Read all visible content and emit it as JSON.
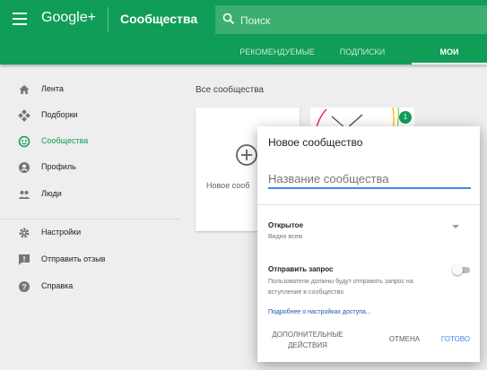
{
  "appbar": {
    "logo": "Google+",
    "title": "Сообщества",
    "search_placeholder": "Поиск"
  },
  "tabs": [
    {
      "label": "РЕКОМЕНДУЕМЫЕ",
      "active": false
    },
    {
      "label": "ПОДПИСКИ",
      "active": false
    },
    {
      "label": "МОИ",
      "active": true
    }
  ],
  "sidebar": {
    "items": [
      {
        "label": "Лента",
        "icon": "home-icon",
        "active": false
      },
      {
        "label": "Подборки",
        "icon": "collections-icon",
        "active": false
      },
      {
        "label": "Сообщества",
        "icon": "communities-icon",
        "active": true
      },
      {
        "label": "Профиль",
        "icon": "profile-icon",
        "active": false
      },
      {
        "label": "Люди",
        "icon": "people-icon",
        "active": false
      },
      {
        "label": "Настройки",
        "icon": "gear-icon",
        "active": false
      },
      {
        "label": "Отправить отзыв",
        "icon": "feedback-icon",
        "active": false
      },
      {
        "label": "Справка",
        "icon": "help-icon",
        "active": false
      }
    ]
  },
  "main": {
    "section_title": "Все сообщества",
    "new_card_label": "Новое сооб",
    "badge_count": "1"
  },
  "dialog": {
    "title": "Новое сообщество",
    "name_placeholder": "Название сообщества",
    "privacy_label": "Открытое",
    "privacy_sub": "Видно всем",
    "request_label": "Отправить запрос",
    "request_desc": "Пользователи должны будут отправить запрос на вступление в сообщество",
    "request_enabled": false,
    "link": "Подробнее о настройках доступа...",
    "btn_more": "ДОПОЛНИТЕЛЬНЫЕ ДЕЙСТВИЯ",
    "btn_cancel": "ОТМЕНА",
    "btn_done": "ГОТОВО"
  },
  "colors": {
    "brand_green": "#0f9d58",
    "accent_blue": "#4285f4",
    "link_blue": "#1a57b4"
  }
}
